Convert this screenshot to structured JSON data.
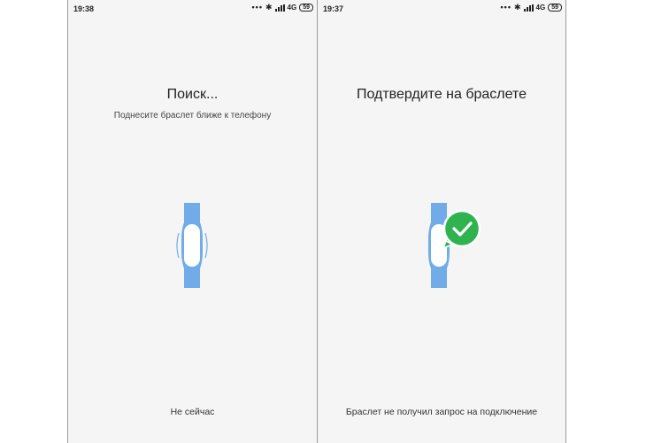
{
  "left_screen": {
    "status": {
      "time": "19:38",
      "dots": "•••",
      "bluetooth": "✱",
      "network": "4G",
      "battery": "59"
    },
    "title": "Поиск...",
    "subtitle": "Поднесите браслет ближе к телефону",
    "bottom_link": "Не сейчас"
  },
  "right_screen": {
    "status": {
      "time": "19:37",
      "dots": "•••",
      "bluetooth": "✱",
      "network": "4G",
      "battery": "59"
    },
    "title": "Подтвердите на браслете",
    "bottom_link": "Браслет не получил запрос на подключение"
  },
  "icons": {
    "fitness_band": "fitness-band-icon",
    "check": "check-circle-icon"
  },
  "colors": {
    "band": "#72ace8",
    "band_screen": "#ffffff",
    "check": "#2eb34f",
    "background": "#f4f5f4"
  }
}
